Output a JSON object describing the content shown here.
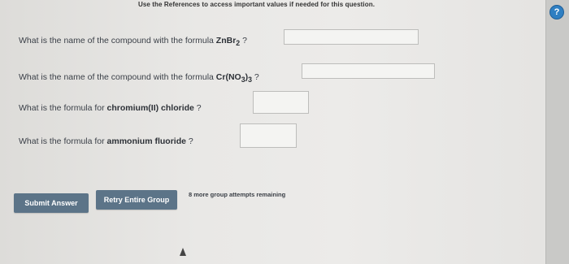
{
  "header": {
    "references_text": "Use the References to access important values if needed for this question."
  },
  "questions": [
    {
      "prefix": "What is the name of the compound with the formula ",
      "bold": "ZnBr",
      "sub": "2",
      "suffix": " ?",
      "answer": ""
    },
    {
      "prefix": "What is the name of the compound with the formula ",
      "bold_parts": [
        "Cr(NO",
        "3",
        ")",
        "3"
      ],
      "suffix": " ?",
      "answer": ""
    },
    {
      "prefix": "What is the formula for ",
      "bold": "chromium(II) chloride",
      "suffix": " ?",
      "answer": ""
    },
    {
      "prefix": "What is the formula for ",
      "bold": "ammonium fluoride",
      "suffix": " ?",
      "answer": ""
    }
  ],
  "buttons": {
    "submit_label": "Submit Answer",
    "retry_label": "Retry Entire Group"
  },
  "status": {
    "attempts_text": "8 more group attempts remaining"
  },
  "icons": {
    "help": "?"
  },
  "colors": {
    "button_bg": "#5c7488",
    "help_icon": "#2f7fc2"
  }
}
